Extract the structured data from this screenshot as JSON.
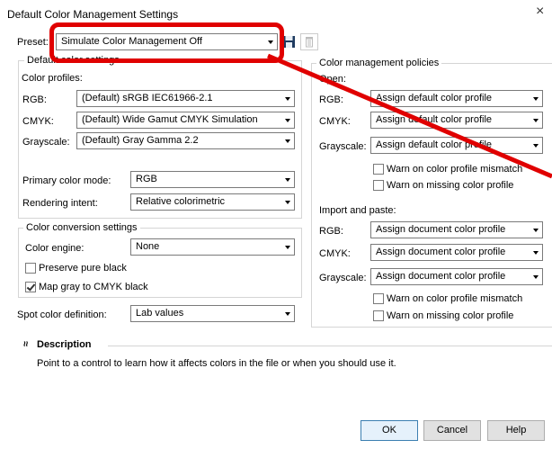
{
  "window": {
    "title": "Default Color Management Settings",
    "close_glyph": "×"
  },
  "preset": {
    "label": "Preset:",
    "value": "Simulate Color Management Off"
  },
  "default_color": {
    "group_title": "Default color settings",
    "profiles_label": "Color profiles:",
    "rgb_label": "RGB:",
    "rgb_value": "(Default) sRGB IEC61966-2.1",
    "cmyk_label": "CMYK:",
    "cmyk_value": "(Default) Wide Gamut CMYK Simulation",
    "gray_label": "Grayscale:",
    "gray_value": "(Default) Gray Gamma 2.2",
    "primary_label": "Primary color mode:",
    "primary_value": "RGB",
    "intent_label": "Rendering intent:",
    "intent_value": "Relative colorimetric"
  },
  "conversion": {
    "group_title": "Color conversion settings",
    "engine_label": "Color engine:",
    "engine_value": "None",
    "preserve_black": "Preserve pure black",
    "preserve_black_checked": false,
    "map_gray": "Map gray to CMYK black",
    "map_gray_checked": true
  },
  "spot": {
    "label": "Spot color definition:",
    "value": "Lab values"
  },
  "policies": {
    "group_title": "Color management policies",
    "open_label": "Open:",
    "rgb_label": "RGB:",
    "open_rgb": "Assign default color profile",
    "cmyk_label": "CMYK:",
    "open_cmyk": "Assign default color profile",
    "gray_label": "Grayscale:",
    "open_gray": "Assign default color profile",
    "warn_mismatch": "Warn on color profile mismatch",
    "warn_missing": "Warn on missing color profile",
    "import_label": "Import and paste:",
    "import_rgb": "Assign document color profile",
    "import_cmyk": "Assign document color profile",
    "import_gray": "Assign document color profile"
  },
  "description": {
    "toggle_glyph": "≈",
    "title": "Description",
    "text": "Point to a control to learn how it affects colors in the file or when you should use it."
  },
  "buttons": {
    "ok": "OK",
    "cancel": "Cancel",
    "help": "Help"
  },
  "colors": {
    "annotation": "#e00000"
  }
}
